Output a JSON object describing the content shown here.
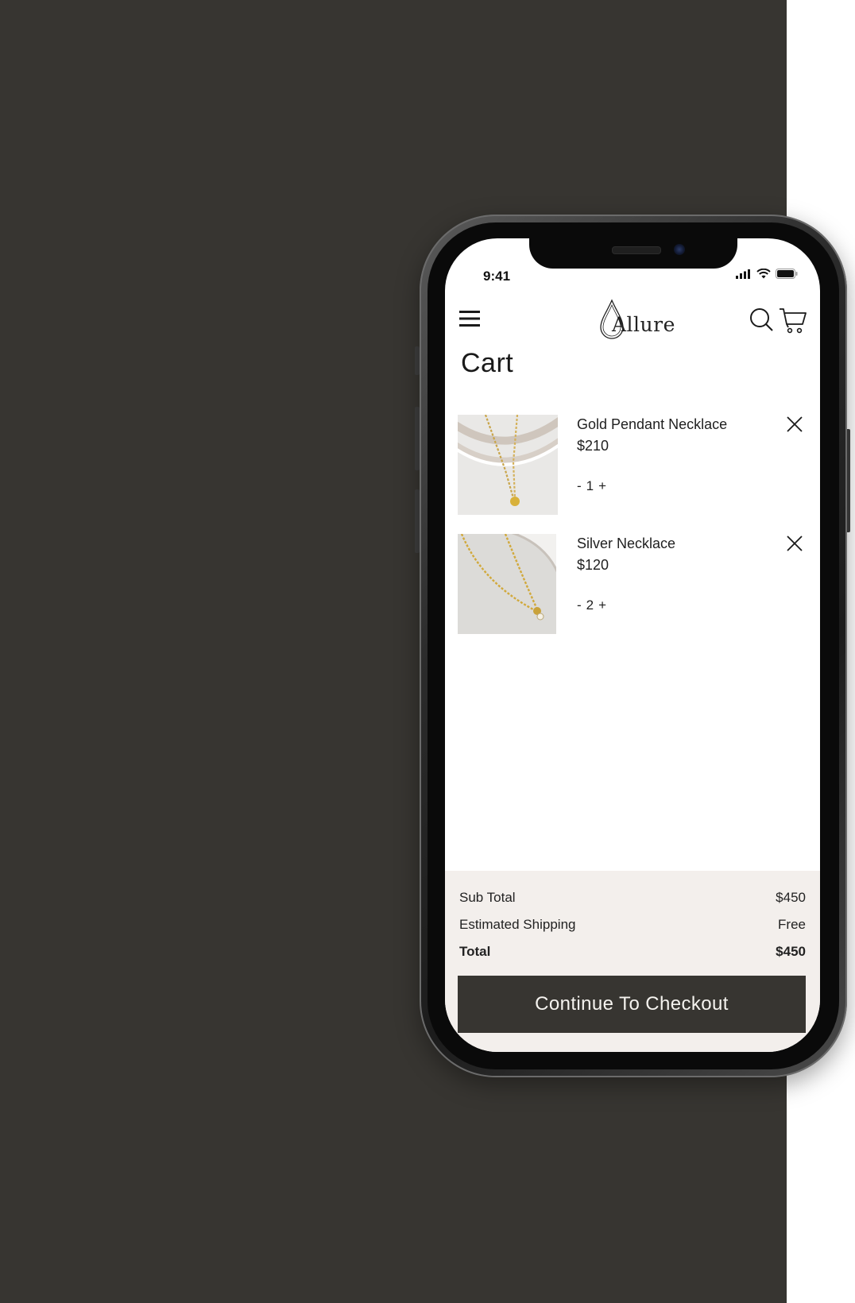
{
  "status": {
    "time": "9:41"
  },
  "header": {
    "logo_text": "Allure"
  },
  "page": {
    "title": "Cart"
  },
  "cart": {
    "items": [
      {
        "name": "Gold Pendant Necklace",
        "price": "$210",
        "qty_minus": "-",
        "quantity": "1",
        "qty_plus": "+"
      },
      {
        "name": "Silver Necklace",
        "price": "$120",
        "qty_minus": "-",
        "quantity": "2",
        "qty_plus": "+"
      }
    ]
  },
  "summary": {
    "subtotal_label": "Sub Total",
    "subtotal_value": "$450",
    "shipping_label": "Estimated Shipping",
    "shipping_value": "Free",
    "total_label": "Total",
    "total_value": "$450",
    "checkout_label": "Continue To Checkout"
  },
  "icons": {
    "menu": "hamburger-menu-icon",
    "search": "search-icon",
    "cart": "shopping-cart-icon",
    "remove": "close-icon",
    "signal": "cellular-signal-icon",
    "wifi": "wifi-icon",
    "battery": "battery-icon"
  },
  "colors": {
    "background_dark": "#373531",
    "summary_background": "#f3efec",
    "button_background": "#373531",
    "button_text": "#f5f3ef",
    "text": "#1f1f1f"
  }
}
